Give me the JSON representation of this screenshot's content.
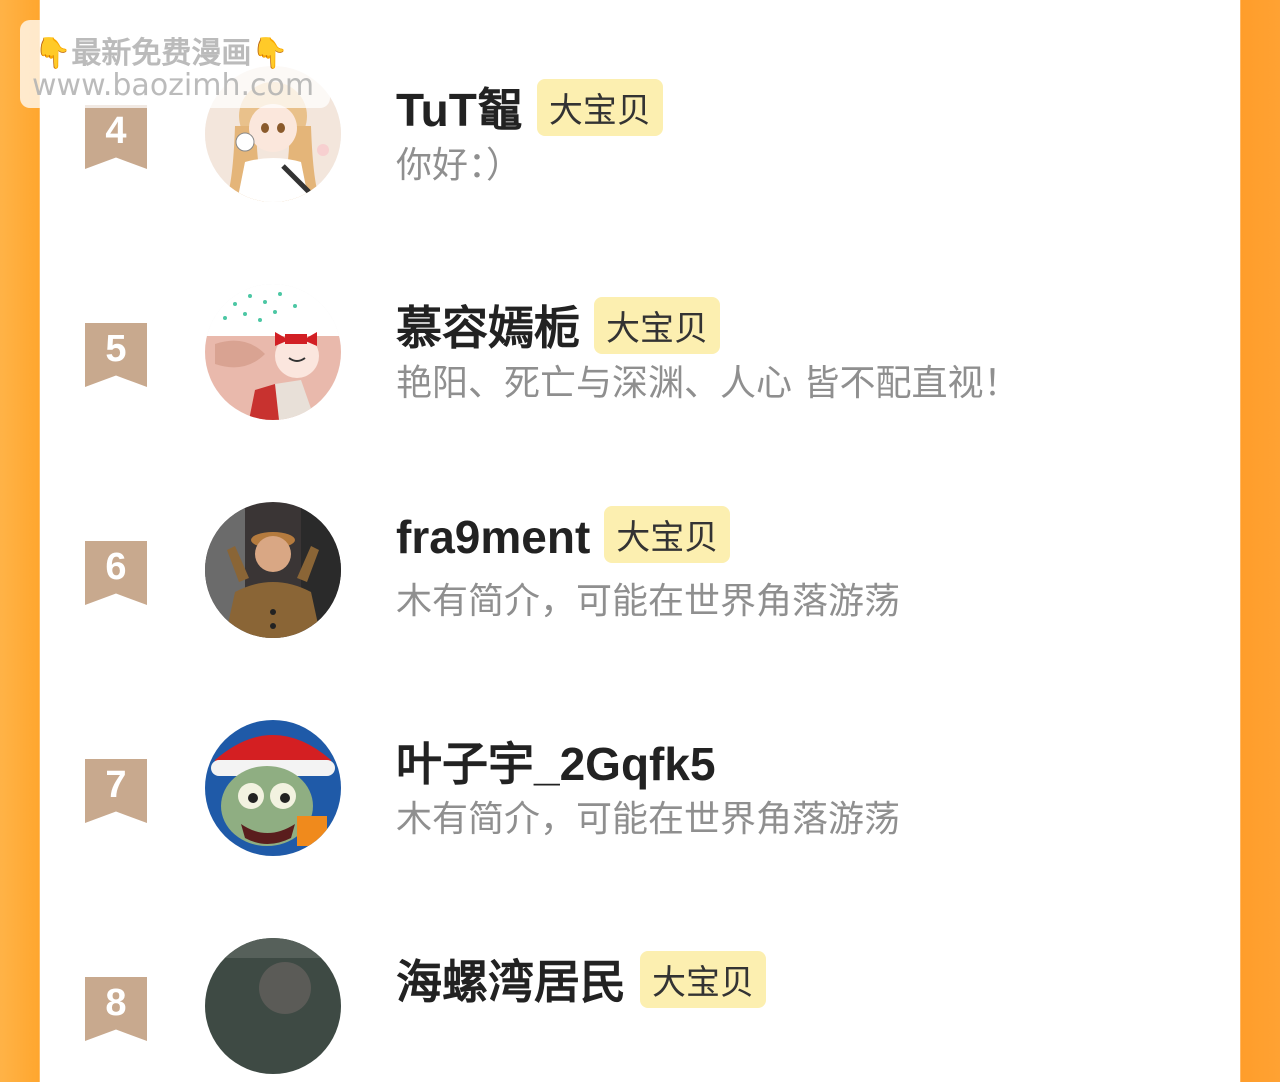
{
  "badge_label": "大宝贝",
  "watermark": {
    "hand_left": "👇",
    "text": "最新免费漫画",
    "hand_right": "👇",
    "url": "www.baozimh.com"
  },
  "rows": [
    {
      "rank": "4",
      "name": "TuT鼅",
      "badge": "大宝贝",
      "bio": "你好：）",
      "avatar": "anime-girl-avatar"
    },
    {
      "rank": "5",
      "name": "慕容嫣栀",
      "badge": "大宝贝",
      "bio": "艳阳、死亡与深渊、人心 皆不配直视！",
      "avatar": "anime-girl-red-bow-avatar"
    },
    {
      "rank": "6",
      "name": "fra9ment",
      "badge": "大宝贝",
      "bio": "木有简介，可能在世界角落游荡",
      "avatar": "child-photo-avatar"
    },
    {
      "rank": "7",
      "name": "叶子宇_2Gqfk5",
      "badge": "",
      "bio": "木有简介，可能在世界角落游荡",
      "avatar": "zombie-santa-avatar"
    },
    {
      "rank": "8",
      "name": "海螺湾居民",
      "badge": "大宝贝",
      "bio": "",
      "avatar": "dark-photo-avatar"
    }
  ]
}
